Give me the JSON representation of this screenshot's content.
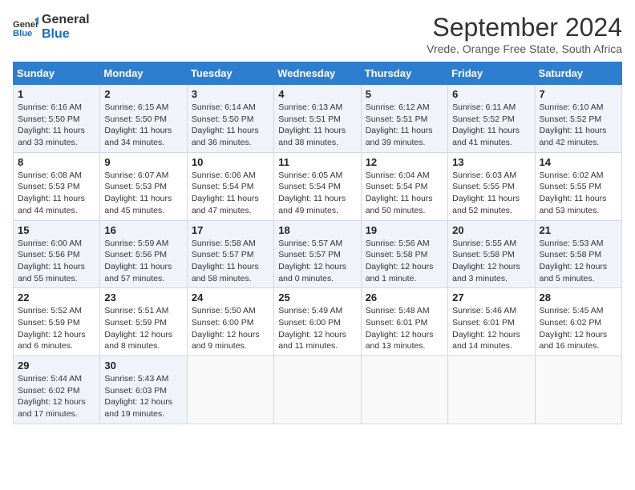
{
  "logo": {
    "line1": "General",
    "line2": "Blue"
  },
  "title": "September 2024",
  "subtitle": "Vrede, Orange Free State, South Africa",
  "days_of_week": [
    "Sunday",
    "Monday",
    "Tuesday",
    "Wednesday",
    "Thursday",
    "Friday",
    "Saturday"
  ],
  "weeks": [
    [
      {
        "day": "1",
        "sunrise": "6:16 AM",
        "sunset": "5:50 PM",
        "daylight": "11 hours and 33 minutes."
      },
      {
        "day": "2",
        "sunrise": "6:15 AM",
        "sunset": "5:50 PM",
        "daylight": "11 hours and 34 minutes."
      },
      {
        "day": "3",
        "sunrise": "6:14 AM",
        "sunset": "5:50 PM",
        "daylight": "11 hours and 36 minutes."
      },
      {
        "day": "4",
        "sunrise": "6:13 AM",
        "sunset": "5:51 PM",
        "daylight": "11 hours and 38 minutes."
      },
      {
        "day": "5",
        "sunrise": "6:12 AM",
        "sunset": "5:51 PM",
        "daylight": "11 hours and 39 minutes."
      },
      {
        "day": "6",
        "sunrise": "6:11 AM",
        "sunset": "5:52 PM",
        "daylight": "11 hours and 41 minutes."
      },
      {
        "day": "7",
        "sunrise": "6:10 AM",
        "sunset": "5:52 PM",
        "daylight": "11 hours and 42 minutes."
      }
    ],
    [
      {
        "day": "8",
        "sunrise": "6:08 AM",
        "sunset": "5:53 PM",
        "daylight": "11 hours and 44 minutes."
      },
      {
        "day": "9",
        "sunrise": "6:07 AM",
        "sunset": "5:53 PM",
        "daylight": "11 hours and 45 minutes."
      },
      {
        "day": "10",
        "sunrise": "6:06 AM",
        "sunset": "5:54 PM",
        "daylight": "11 hours and 47 minutes."
      },
      {
        "day": "11",
        "sunrise": "6:05 AM",
        "sunset": "5:54 PM",
        "daylight": "11 hours and 49 minutes."
      },
      {
        "day": "12",
        "sunrise": "6:04 AM",
        "sunset": "5:54 PM",
        "daylight": "11 hours and 50 minutes."
      },
      {
        "day": "13",
        "sunrise": "6:03 AM",
        "sunset": "5:55 PM",
        "daylight": "11 hours and 52 minutes."
      },
      {
        "day": "14",
        "sunrise": "6:02 AM",
        "sunset": "5:55 PM",
        "daylight": "11 hours and 53 minutes."
      }
    ],
    [
      {
        "day": "15",
        "sunrise": "6:00 AM",
        "sunset": "5:56 PM",
        "daylight": "11 hours and 55 minutes."
      },
      {
        "day": "16",
        "sunrise": "5:59 AM",
        "sunset": "5:56 PM",
        "daylight": "11 hours and 57 minutes."
      },
      {
        "day": "17",
        "sunrise": "5:58 AM",
        "sunset": "5:57 PM",
        "daylight": "11 hours and 58 minutes."
      },
      {
        "day": "18",
        "sunrise": "5:57 AM",
        "sunset": "5:57 PM",
        "daylight": "12 hours and 0 minutes."
      },
      {
        "day": "19",
        "sunrise": "5:56 AM",
        "sunset": "5:58 PM",
        "daylight": "12 hours and 1 minute."
      },
      {
        "day": "20",
        "sunrise": "5:55 AM",
        "sunset": "5:58 PM",
        "daylight": "12 hours and 3 minutes."
      },
      {
        "day": "21",
        "sunrise": "5:53 AM",
        "sunset": "5:58 PM",
        "daylight": "12 hours and 5 minutes."
      }
    ],
    [
      {
        "day": "22",
        "sunrise": "5:52 AM",
        "sunset": "5:59 PM",
        "daylight": "12 hours and 6 minutes."
      },
      {
        "day": "23",
        "sunrise": "5:51 AM",
        "sunset": "5:59 PM",
        "daylight": "12 hours and 8 minutes."
      },
      {
        "day": "24",
        "sunrise": "5:50 AM",
        "sunset": "6:00 PM",
        "daylight": "12 hours and 9 minutes."
      },
      {
        "day": "25",
        "sunrise": "5:49 AM",
        "sunset": "6:00 PM",
        "daylight": "12 hours and 11 minutes."
      },
      {
        "day": "26",
        "sunrise": "5:48 AM",
        "sunset": "6:01 PM",
        "daylight": "12 hours and 13 minutes."
      },
      {
        "day": "27",
        "sunrise": "5:46 AM",
        "sunset": "6:01 PM",
        "daylight": "12 hours and 14 minutes."
      },
      {
        "day": "28",
        "sunrise": "5:45 AM",
        "sunset": "6:02 PM",
        "daylight": "12 hours and 16 minutes."
      }
    ],
    [
      {
        "day": "29",
        "sunrise": "5:44 AM",
        "sunset": "6:02 PM",
        "daylight": "12 hours and 17 minutes."
      },
      {
        "day": "30",
        "sunrise": "5:43 AM",
        "sunset": "6:03 PM",
        "daylight": "12 hours and 19 minutes."
      },
      null,
      null,
      null,
      null,
      null
    ]
  ]
}
